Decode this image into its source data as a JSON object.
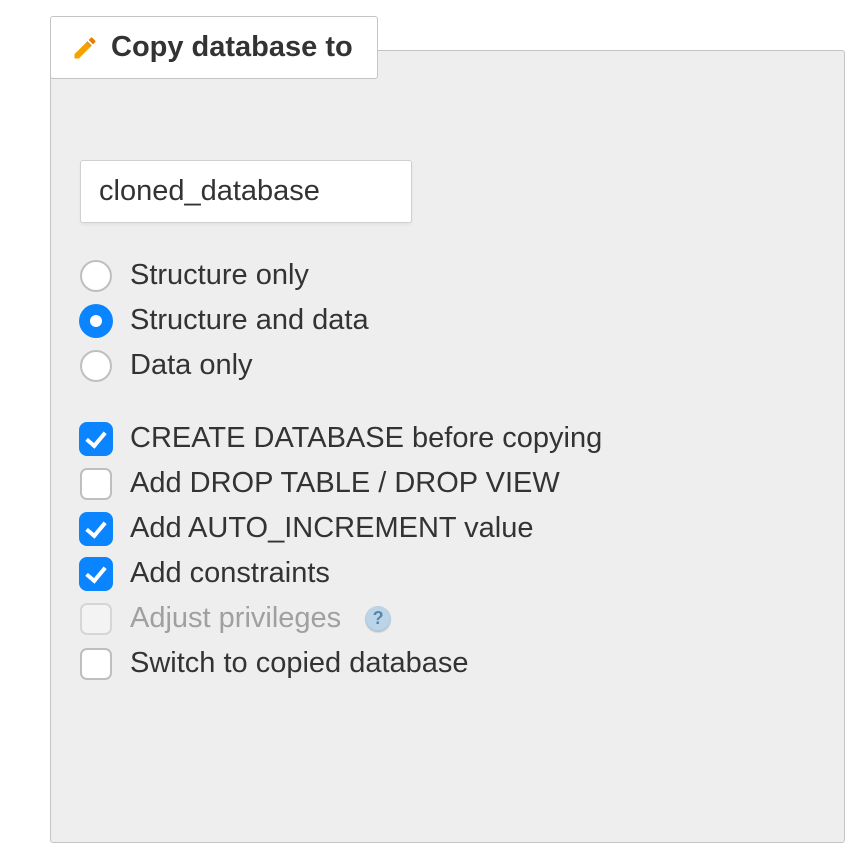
{
  "panel": {
    "title": "Copy database to",
    "target_name": "cloned_database"
  },
  "copy_mode": {
    "options": {
      "structure_only": "Structure only",
      "structure_and_data": "Structure and data",
      "data_only": "Data only"
    },
    "selected": "structure_and_data"
  },
  "options": {
    "create_db": {
      "label": "CREATE DATABASE before copying",
      "checked": true
    },
    "drop_table": {
      "label": "Add DROP TABLE / DROP VIEW",
      "checked": false
    },
    "auto_increment": {
      "label": "Add AUTO_INCREMENT value",
      "checked": true
    },
    "constraints": {
      "label": "Add constraints",
      "checked": true
    },
    "adjust_privileges": {
      "label": "Adjust privileges",
      "checked": false,
      "disabled": true
    },
    "switch_to_copied": {
      "label": "Switch to copied database",
      "checked": false
    }
  }
}
